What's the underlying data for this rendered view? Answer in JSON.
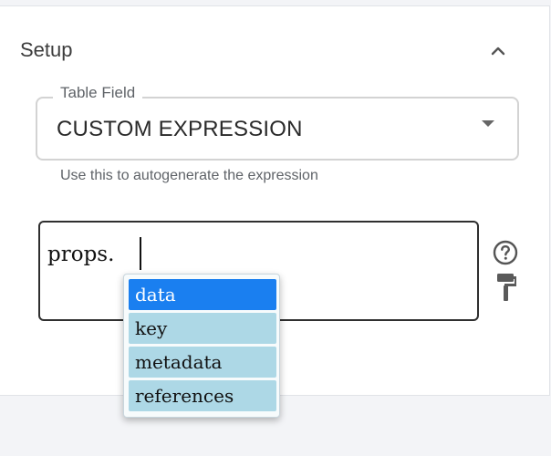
{
  "setup": {
    "title": "Setup",
    "collapse_icon": "chevron-up-icon"
  },
  "table_field": {
    "label": "Table Field",
    "value": "CUSTOM EXPRESSION",
    "helper": "Use this to autogenerate the expression"
  },
  "editor": {
    "text": "props."
  },
  "autocomplete": {
    "items": [
      "data",
      "key",
      "metadata",
      "references"
    ],
    "selected_index": 0
  },
  "icons": {
    "help": "help-circle-icon",
    "format": "paint-roller-icon"
  },
  "colors": {
    "selected_bg": "#1a7ff0",
    "item_bg": "#add8e6"
  }
}
